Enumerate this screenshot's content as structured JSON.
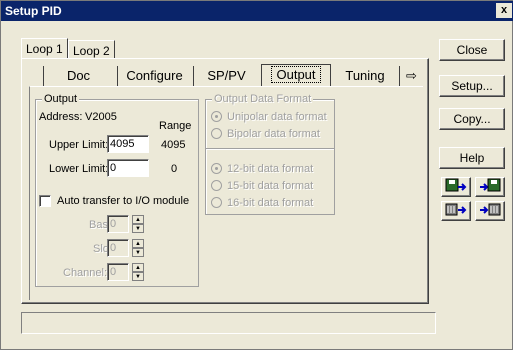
{
  "window": {
    "title": "Setup PID",
    "close_glyph": "x"
  },
  "loop_tabs": [
    {
      "label": "Loop 1",
      "active": true
    },
    {
      "label": "Loop 2",
      "active": false
    }
  ],
  "inner_tabs": [
    {
      "label": "Doc"
    },
    {
      "label": "Configure"
    },
    {
      "label": "SP/PV"
    },
    {
      "label": "Output",
      "active": true
    },
    {
      "label": "Tuning"
    }
  ],
  "tab_scroll_icon": "⇨",
  "output_group": {
    "legend": "Output",
    "address_label": "Address:",
    "address_value": "V2005",
    "range_header": "Range",
    "upper_label": "Upper Limit:",
    "upper_value": "4095",
    "upper_range": "4095",
    "lower_label": "Lower Limit:",
    "lower_value": "0",
    "lower_range": "0",
    "auto_transfer_label": "Auto transfer to I/O module",
    "auto_transfer_checked": false,
    "base_label": "Base:",
    "base_value": "0",
    "slot_label": "Slot:",
    "slot_value": "0",
    "channel_label": "Channel:",
    "channel_value": "0"
  },
  "format_group": {
    "legend": "Output Data Format",
    "polarity_options": [
      {
        "label": "Unipolar data format",
        "selected": true
      },
      {
        "label": "Bipolar data format",
        "selected": false
      }
    ],
    "bit_options": [
      {
        "label": "12-bit data format",
        "selected": true
      },
      {
        "label": "15-bit data format",
        "selected": false
      },
      {
        "label": "16-bit data format",
        "selected": false
      }
    ]
  },
  "buttons": {
    "close": "Close",
    "setup": "Setup...",
    "copy": "Copy...",
    "help": "Help"
  },
  "colors": {
    "titlebar": "#0a246a",
    "face": "#ece9d8",
    "disabled_text": "#a0a0a0"
  }
}
